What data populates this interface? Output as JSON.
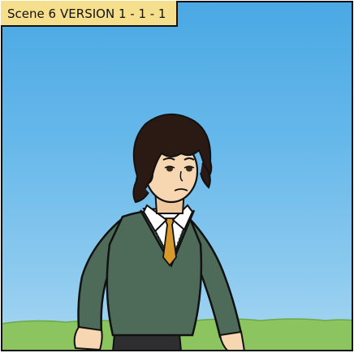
{
  "scene_label": {
    "scene": "Scene 6",
    "version": "VERSION 1 - 1 - 1"
  },
  "colors": {
    "sky_top": "#4aa8e4",
    "sky_bottom": "#a9d7f1",
    "grass": "#8cc560",
    "sweater": "#4e6b5a",
    "tie": "#d89a2c",
    "hair": "#2b1a14",
    "skin": "#f6d7b2",
    "label_bg": "#f6df8c"
  },
  "figure": {
    "description_icon": "student-character"
  }
}
